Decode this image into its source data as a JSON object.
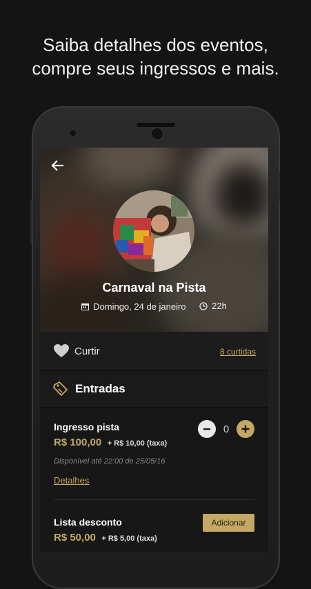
{
  "headline": {
    "line1": "Saiba detalhes dos eventos,",
    "line2": "compre seus ingressos e mais."
  },
  "event": {
    "title": "Carnaval na Pista",
    "date": "Domingo, 24 de janeiro",
    "time": "22h"
  },
  "social": {
    "like_label": "Curtir",
    "likes_count": "8 curtidas"
  },
  "tickets_section": {
    "title": "Entradas",
    "items": [
      {
        "name": "Ingresso pista",
        "price": "R$ 100,00",
        "fee": "+ R$ 10,00 (taxa)",
        "availability": "Disponível até 22:00 de 25/05/16",
        "details_label": "Detalhes",
        "quantity": "0"
      },
      {
        "name": "Lista desconto",
        "price": "R$ 50,00",
        "fee": "+ R$ 5,00 (taxa)",
        "action_label": "Adicionar"
      }
    ]
  },
  "icons": {
    "back": "arrow-left-icon",
    "calendar": "calendar-icon",
    "clock": "clock-icon",
    "like": "heart-icon",
    "tickets": "ticket-icon",
    "minus": "minus-icon",
    "plus": "plus-icon"
  },
  "colors": {
    "accent": "#c5a863",
    "background": "#141414",
    "card": "#1c1c1c"
  }
}
